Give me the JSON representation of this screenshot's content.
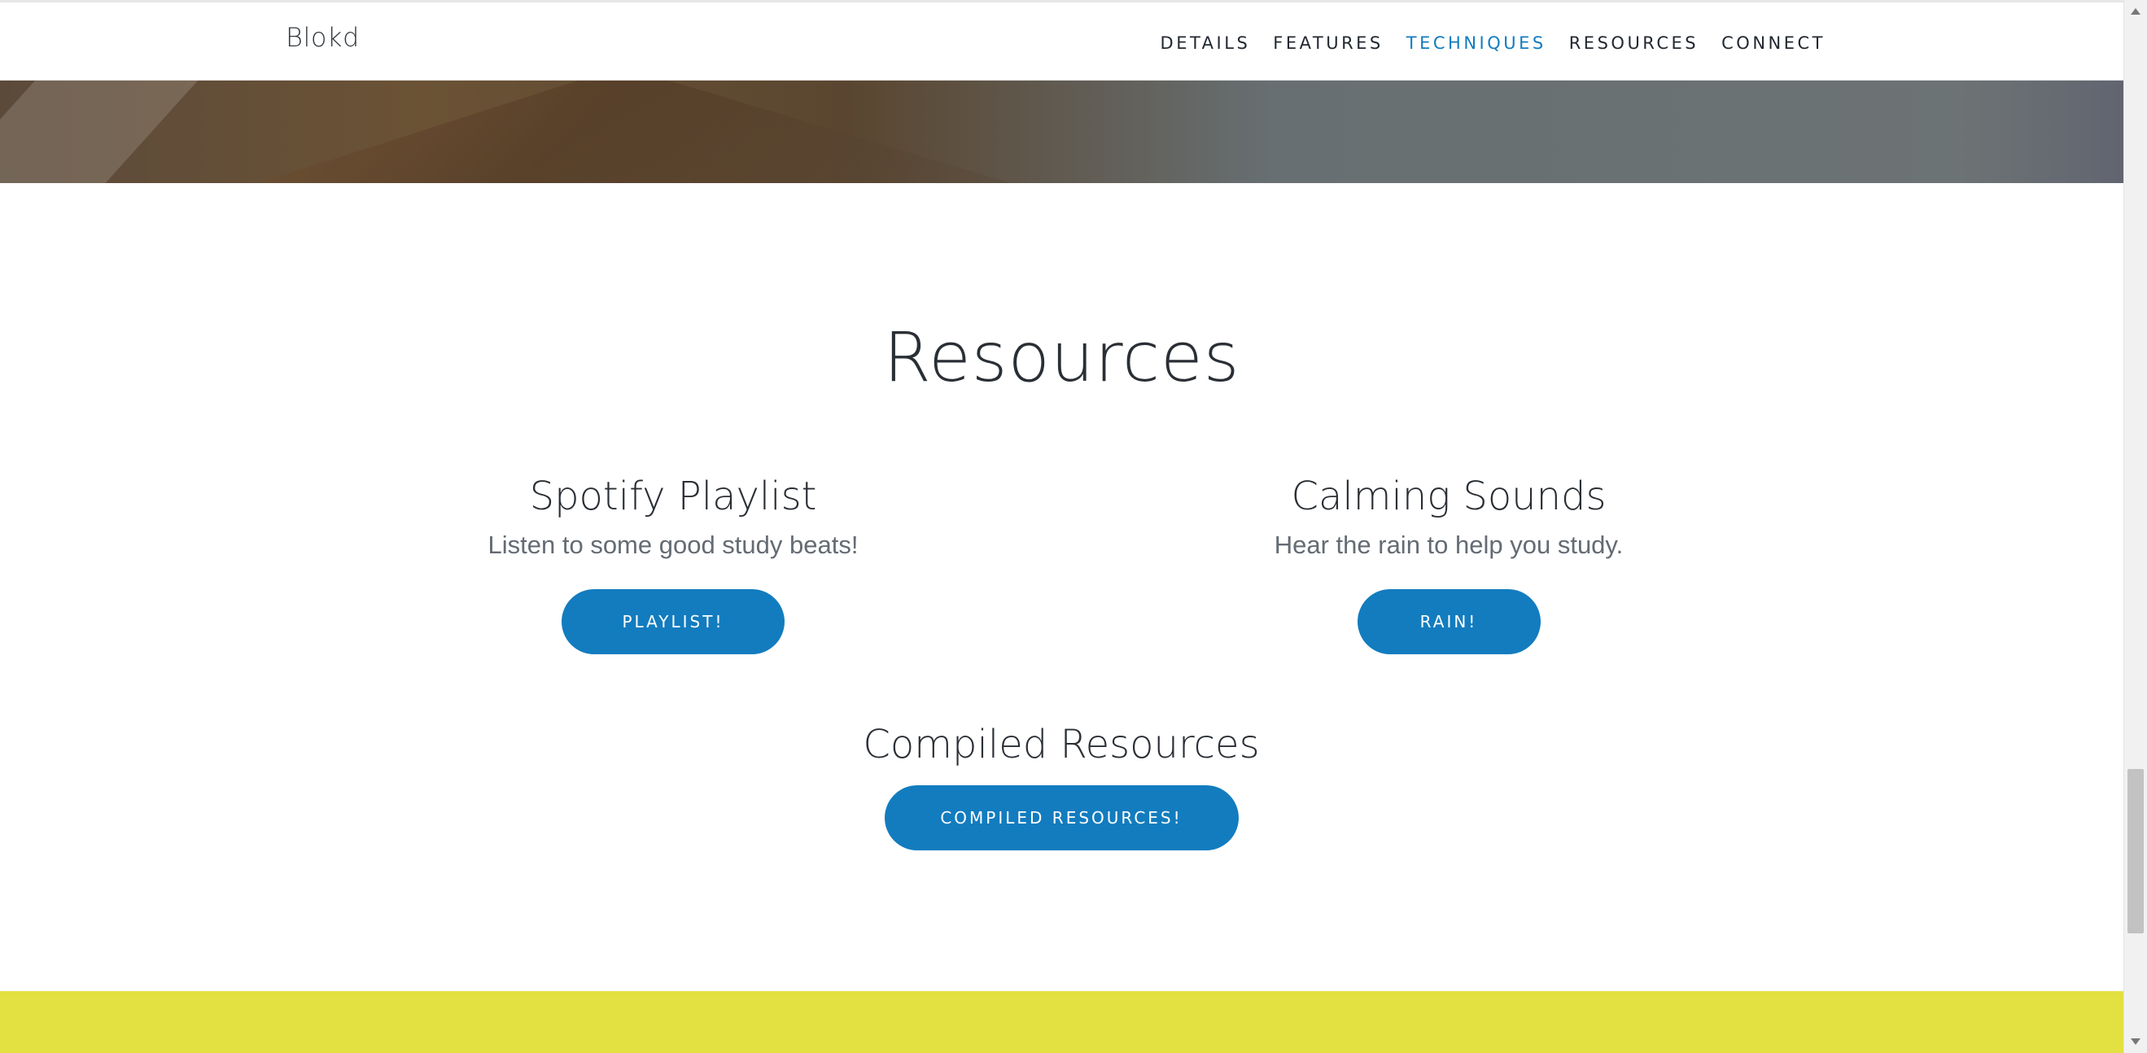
{
  "colors": {
    "accent": "#127cbf",
    "band": "#e3e041"
  },
  "navbar": {
    "brand": "Blokd",
    "links": [
      {
        "label": "DETAILS"
      },
      {
        "label": "FEATURES"
      },
      {
        "label": "TECHNIQUES",
        "active": true
      },
      {
        "label": "RESOURCES"
      },
      {
        "label": "CONNECT"
      }
    ]
  },
  "resources": {
    "title": "Resources",
    "cards": [
      {
        "title": "Spotify Playlist",
        "text": "Listen to some good study beats!",
        "button": "PLAYLIST!"
      },
      {
        "title": "Calming Sounds",
        "text": "Hear the rain to help you study.",
        "button": "RAIN!"
      },
      {
        "title": "Compiled Resources",
        "button": "COMPILED RESOURCES!"
      }
    ]
  }
}
